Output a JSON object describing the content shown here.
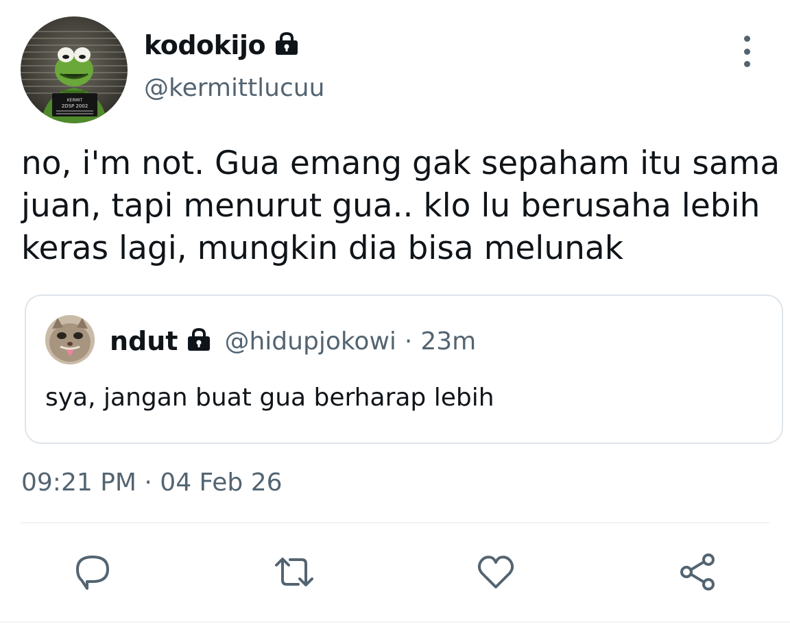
{
  "tweet": {
    "author": {
      "display_name": "kodokijo",
      "handle": "@kermittlucuu",
      "avatar_icon": "kermit-mugshot-avatar",
      "locked_icon": "lock-icon"
    },
    "more_icon": "more-vertical-icon",
    "text": "no, i'm not. Gua emang gak sepaham itu sama juan, tapi menurut gua.. klo lu berusaha lebih keras lagi, mungkin dia bisa melunak",
    "quoted": {
      "display_name": "ndut",
      "handle": "@hidupjokowi",
      "separator": "·",
      "time": "23m",
      "text": "sya, jangan buat gua berharap lebih",
      "avatar_icon": "cat-tongue-avatar",
      "locked_icon": "lock-icon"
    },
    "timestamp": "09:21 PM · 04 Feb 26",
    "actions": [
      "reply-icon",
      "retweet-icon",
      "like-icon",
      "share-icon"
    ]
  },
  "avatar_badge": {
    "line1": "KERMIT",
    "line2": "2DSP 2002"
  },
  "colors": {
    "text": "#0f1419",
    "secondary": "#536471",
    "border": "#dfe5ea",
    "divider": "#eff3f4"
  }
}
